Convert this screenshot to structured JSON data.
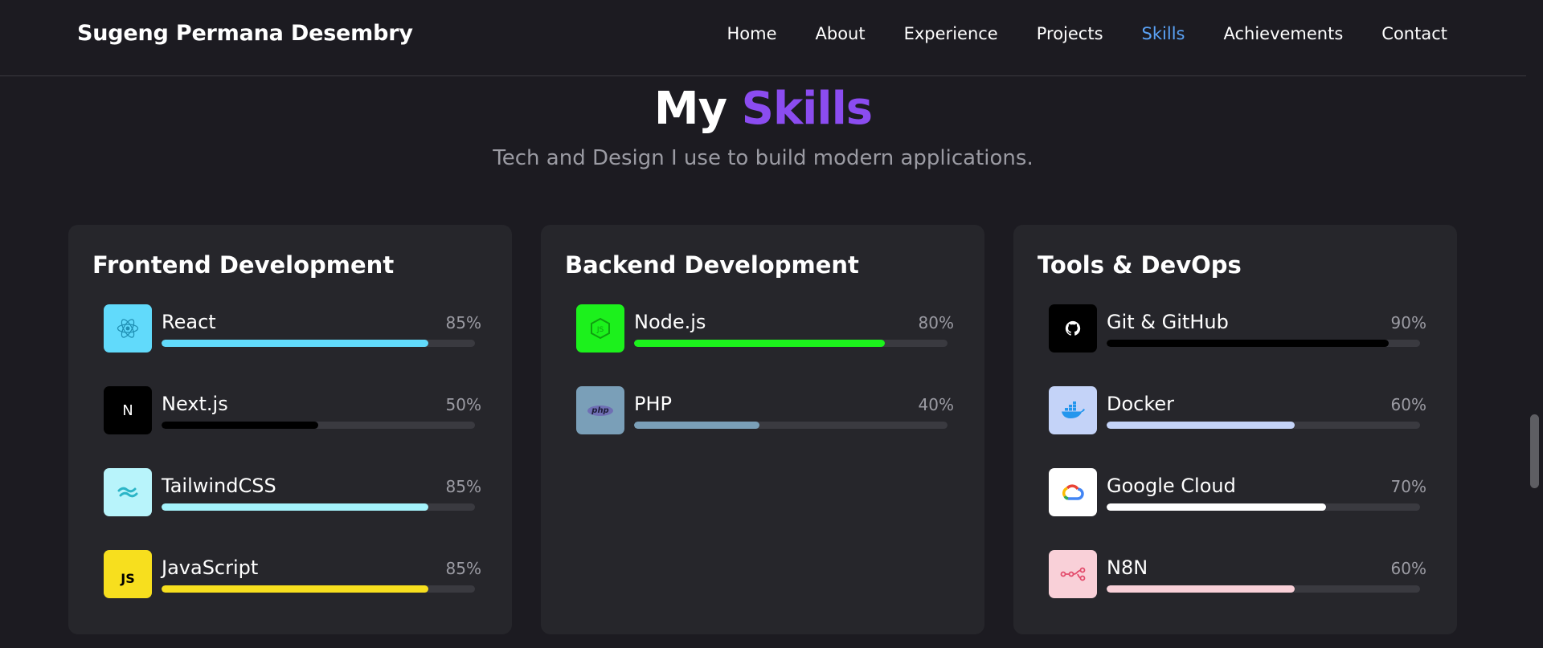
{
  "header": {
    "brand": "Sugeng Permana Desembry",
    "nav": [
      {
        "label": "Home",
        "active": false
      },
      {
        "label": "About",
        "active": false
      },
      {
        "label": "Experience",
        "active": false
      },
      {
        "label": "Projects",
        "active": false
      },
      {
        "label": "Skills",
        "active": true
      },
      {
        "label": "Achievements",
        "active": false
      },
      {
        "label": "Contact",
        "active": false
      }
    ]
  },
  "section": {
    "title_main": "My",
    "title_accent": "Skills",
    "subtitle": "Tech and Design I use to build modern applications."
  },
  "colors": {
    "accent_purple": "#8b4cf0",
    "accent_link": "#5aa2f5"
  },
  "categories": [
    {
      "title": "Frontend Development",
      "skills": [
        {
          "name": "React",
          "percent": 85,
          "percent_label": "85%",
          "color": "#61dafb",
          "icon_bg": "#61dafb",
          "icon": "react-icon"
        },
        {
          "name": "Next.js",
          "percent": 50,
          "percent_label": "50%",
          "color": "#000000",
          "icon_bg": "#000000",
          "icon": "nextjs-icon",
          "icon_text": "N"
        },
        {
          "name": "TailwindCSS",
          "percent": 85,
          "percent_label": "85%",
          "color": "#a5f3fc",
          "icon_bg": "#b8f4fb",
          "icon": "tailwind-icon"
        },
        {
          "name": "JavaScript",
          "percent": 85,
          "percent_label": "85%",
          "color": "#f7df1e",
          "icon_bg": "#f7df1e",
          "icon": "javascript-icon",
          "icon_text": "JS"
        }
      ]
    },
    {
      "title": "Backend Development",
      "skills": [
        {
          "name": "Node.js",
          "percent": 80,
          "percent_label": "80%",
          "color": "#1cf11c",
          "icon_bg": "#1cf11c",
          "icon": "nodejs-icon"
        },
        {
          "name": "PHP",
          "percent": 40,
          "percent_label": "40%",
          "color": "#7a9fb8",
          "icon_bg": "#7a9fb8",
          "icon": "php-icon",
          "icon_text": "php"
        }
      ]
    },
    {
      "title": "Tools & DevOps",
      "skills": [
        {
          "name": "Git & GitHub",
          "percent": 90,
          "percent_label": "90%",
          "color": "#000000",
          "icon_bg": "#000000",
          "icon": "github-icon"
        },
        {
          "name": "Docker",
          "percent": 60,
          "percent_label": "60%",
          "color": "#c4d3f8",
          "icon_bg": "#c4d3f8",
          "icon": "docker-icon"
        },
        {
          "name": "Google Cloud",
          "percent": 70,
          "percent_label": "70%",
          "color": "#ffffff",
          "icon_bg": "#ffffff",
          "icon": "google-cloud-icon"
        },
        {
          "name": "N8N",
          "percent": 60,
          "percent_label": "60%",
          "color": "#f9d0d8",
          "icon_bg": "#f9d0d8",
          "icon": "n8n-icon"
        }
      ]
    }
  ]
}
